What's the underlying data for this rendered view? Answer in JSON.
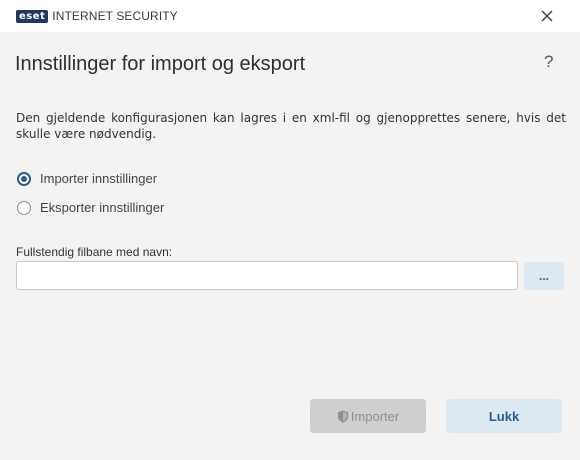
{
  "titlebar": {
    "logo_text": "eset",
    "product_name": "INTERNET SECURITY"
  },
  "page": {
    "title": "Innstillinger for import og eksport",
    "help_icon": "?",
    "description": "Den gjeldende konfigurasjonen kan lagres i en xml-fil og gjenopprettes senere, hvis det skulle være nødvendig."
  },
  "options": {
    "import_label": "Importer innstillinger",
    "export_label": "Eksporter innstillinger",
    "selected": "import"
  },
  "path": {
    "label": "Fullstendig filbane med navn:",
    "value": "",
    "browse_label": "..."
  },
  "buttons": {
    "import_label": "Importer",
    "close_label": "Lukk"
  },
  "colors": {
    "accent": "#2b5d8c",
    "background": "#f3f3f4",
    "secondary_button": "#dce8f2",
    "disabled_button": "#cfcfd0"
  }
}
